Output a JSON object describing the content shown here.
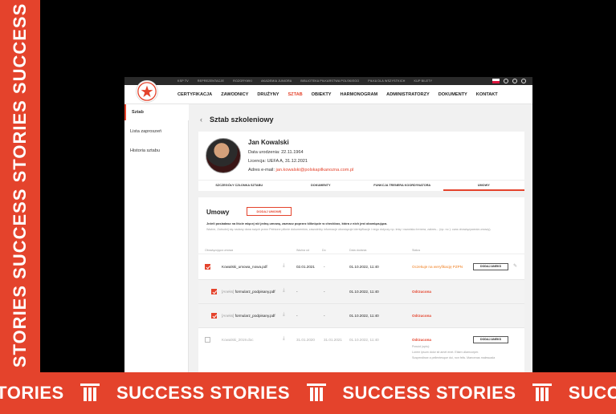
{
  "banner": {
    "vertical_text": "ESS STORIES SUCCESS STORIES SUCCESS",
    "bottom_items": [
      "STORIES",
      "SUCCESS STORIES",
      "SUCCESS STORIES",
      "SUCCESS"
    ]
  },
  "topnav": [
    "KSP TV",
    "REPREZENTACJE",
    "ROZGRYWKI",
    "AKADEMIA JUNIORA",
    "BIBLIOTEKA PIŁKARSTWA POLSKIEGO",
    "PIŁKA DLA WSZYSTKICH",
    "KUP BILETY"
  ],
  "mainnav": [
    {
      "label": "CERTYFIKACJA"
    },
    {
      "label": "ZAWODNICY"
    },
    {
      "label": "DRUŻYNY"
    },
    {
      "label": "SZTAB"
    },
    {
      "label": "OBIEKTY"
    },
    {
      "label": "HARMONOGRAM"
    },
    {
      "label": "ADMINISTRATORZY"
    },
    {
      "label": "DOKUMENTY"
    },
    {
      "label": "KONTAKT"
    }
  ],
  "sidebar": [
    "Sztab",
    "Lista zaproszeń",
    "Historia sztabu"
  ],
  "page": {
    "title": "Sztab szkoleniowy"
  },
  "person": {
    "name": "Jan Kowalski",
    "birth_label": "Data urodzenia:",
    "birth": "22.11.1964",
    "license_label": "Licencja:",
    "license": "UEFA A, 31.12.2021",
    "email_label": "Adres e-mail:",
    "email": "jan.kowalski@polskapilkanozna.com.pl"
  },
  "tabs": [
    "SZCZEGÓŁY CZŁONKA SZTABU",
    "DOKUMENTY",
    "FUNKCJA TRENERA KOORDYNATORA",
    "UMOWY"
  ],
  "contracts": {
    "title": "Umowy",
    "add_button": "DODAJ UMOWĘ",
    "info": "Jeżeli posiadasz na liście więcej niż jedną umowę, zaznacz poprzez kliknięcie w checkbox, która z nich jest obowiązująca.",
    "info2": "Ważne, Zatrudnij się nadany dana swych przez Pełnione pliknie dokumentów, zawodniky informacje obowiązuje identyfikacje i nego dotyczy np. imię i nazwisko trenera, zakres... (np. no ): czas obowiązywania umowy).",
    "headers": [
      "Obowiązująca umowa",
      "Ważna od",
      "Do",
      "Data dodania",
      "Status"
    ],
    "rows": [
      {
        "name": "Kowalski_umowa_nowa.pdf",
        "prefix": "",
        "from": "02.01.2021",
        "to": "-",
        "added": "01.10.2022, 11:40",
        "status": "Oczekuje na weryfikację PZPN",
        "button": "DODAJ ANEKS"
      },
      {
        "name": "formularz_podpisany.pdf",
        "prefix": "[Aneks]",
        "from": "-",
        "to": "-",
        "added": "01.10.2022, 11:40",
        "status": "Odrzucona"
      },
      {
        "name": "formularz_podpisany.pdf",
        "prefix": "[Aneks]",
        "from": "-",
        "to": "-",
        "added": "01.10.2022, 11:40",
        "status": "Odrzucona"
      },
      {
        "name": "Kowalski_2019.doc",
        "prefix": "",
        "from": "31.01.2020",
        "to": "31.01.2021",
        "added": "01.10.2022, 11:40",
        "status": "Odrzucona",
        "button": "DODAJ ANEKS",
        "reason_label": "Powód (opis):",
        "reason_line1": "Lorem ipsum dolor sit amet enet. Etiam ullamcorper.",
        "reason_line2": "Suspendisse a pellentesque dui, non felis. Maecenas malesuada"
      }
    ]
  },
  "colors": {
    "accent": "#e4432c",
    "warning": "#f07d1d"
  }
}
